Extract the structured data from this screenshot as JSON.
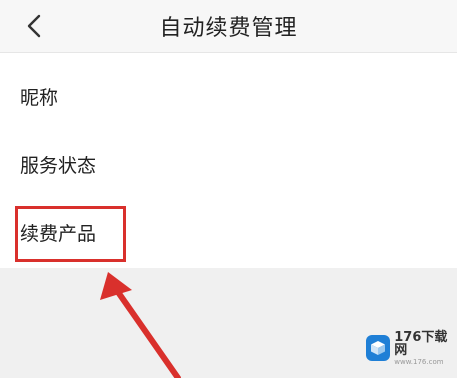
{
  "header": {
    "title": "自动续费管理",
    "back_icon": "chevron-left-icon"
  },
  "list": {
    "items": [
      {
        "label": "昵称"
      },
      {
        "label": "服务状态"
      },
      {
        "label": "续费产品"
      }
    ]
  },
  "annotation": {
    "highlight_color": "#d9302c",
    "arrow_color": "#d9302c"
  },
  "watermark": {
    "text": "176下载网",
    "subtext": "www.176.com"
  }
}
